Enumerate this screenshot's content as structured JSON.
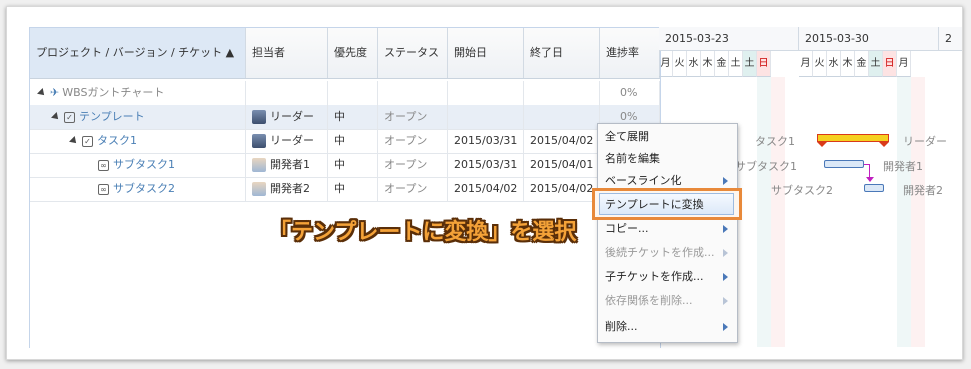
{
  "columns": [
    "プロジェクト / バージョン / チケット ▲",
    "担当者",
    "優先度",
    "ステータス",
    "開始日",
    "終了日",
    "進捗率"
  ],
  "rows": [
    {
      "name": "WBSガントチャート",
      "assignee": "",
      "priority": "",
      "status": "",
      "start": "",
      "end": "",
      "progress": "0%"
    },
    {
      "name": "テンプレート",
      "assignee": "リーダー",
      "priority": "中",
      "status": "オープン",
      "start": "",
      "end": "",
      "progress": "0%"
    },
    {
      "name": "タスク1",
      "assignee": "リーダー",
      "priority": "中",
      "status": "オープン",
      "start": "2015/03/31",
      "end": "2015/04/02",
      "progress": ""
    },
    {
      "name": "サブタスク1",
      "assignee": "開発者1",
      "priority": "中",
      "status": "オープン",
      "start": "2015/03/31",
      "end": "2015/04/01",
      "progress": ""
    },
    {
      "name": "サブタスク2",
      "assignee": "開発者2",
      "priority": "中",
      "status": "オープン",
      "start": "2015/04/02",
      "end": "2015/04/02",
      "progress": ""
    }
  ],
  "gantt": {
    "weeks": [
      "2015-03-23",
      "2015-03-30",
      "2"
    ],
    "days": [
      "月",
      "火",
      "水",
      "木",
      "金",
      "土",
      "日",
      "月",
      "火",
      "水",
      "木",
      "金",
      "土",
      "日",
      "月"
    ],
    "bar_labels": {
      "task1_left": "タスク1",
      "task1_right": "リーダー",
      "sub1_left": "サブタスク1",
      "sub1_right": "開発者1",
      "sub2_left": "サブタスク2",
      "sub2_right": "開発者2"
    },
    "colors": {
      "summary_bar": "#f5d020",
      "summary_edge": "#d93a1a",
      "task_bar": "#dbe8f7",
      "dependency": "#c020c0"
    }
  },
  "context_menu": {
    "items": [
      {
        "label": "全て展開",
        "enabled": true,
        "submenu": false
      },
      {
        "label": "名前を編集",
        "enabled": true,
        "submenu": false
      },
      {
        "label": "ベースライン化",
        "enabled": true,
        "submenu": true
      },
      {
        "label": "テンプレートに変換",
        "enabled": true,
        "submenu": false,
        "highlighted": true
      },
      {
        "label": "コピー...",
        "enabled": true,
        "submenu": true
      },
      {
        "label": "後続チケットを作成...",
        "enabled": false,
        "submenu": true
      },
      {
        "label": "子チケットを作成...",
        "enabled": true,
        "submenu": true
      },
      {
        "label": "依存関係を削除...",
        "enabled": false,
        "submenu": true
      },
      {
        "label": "削除...",
        "enabled": true,
        "submenu": true
      }
    ]
  },
  "callout": "「テンプレートに変換」を選択",
  "colors": {
    "highlight": "#e8893a",
    "callout_fill": "#f4a238",
    "callout_outline": "#5a2e08",
    "link": "#4a7fb5"
  }
}
